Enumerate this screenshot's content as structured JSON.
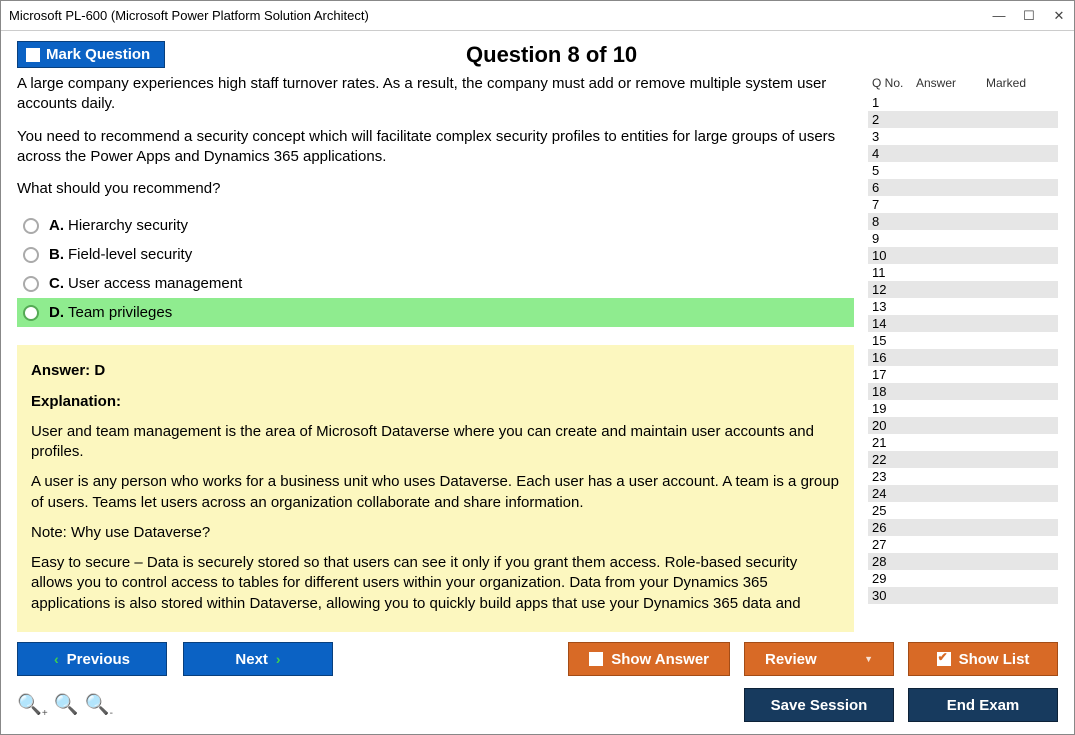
{
  "window": {
    "title": "Microsoft PL-600 (Microsoft Power Platform Solution Architect)"
  },
  "header": {
    "mark_label": "Mark Question",
    "question_title": "Question 8 of 10"
  },
  "question": {
    "para1": "A large company experiences high staff turnover rates. As a result, the company must add or remove multiple system user accounts daily.",
    "para2": "You need to recommend a security concept which will facilitate complex security profiles to entities for large groups of users across the Power Apps and Dynamics 365 applications.",
    "para3": "What should you recommend?"
  },
  "options": {
    "a": {
      "label": "A.",
      "text": "Hierarchy security"
    },
    "b": {
      "label": "B.",
      "text": "Field-level security"
    },
    "c": {
      "label": "C.",
      "text": "User access management"
    },
    "d": {
      "label": "D.",
      "text": "Team privileges"
    }
  },
  "answer": {
    "header": "Answer: D",
    "explanation_label": "Explanation:",
    "p1": "User and team management is the area of Microsoft Dataverse where you can create and maintain user accounts and profiles.",
    "p2": "A user is any person who works for a business unit who uses Dataverse. Each user has a user account. A team is a group of users. Teams let users across an organization collaborate and share information.",
    "p3": "Note: Why use Dataverse?",
    "p4": " Easy to secure – Data is securely stored so that users can see it only if you grant them access. Role-based security allows you to control access to tables for different users within your organization.  Data from your Dynamics 365 applications is also stored within Dataverse, allowing you to quickly build apps that use your Dynamics 365 data and"
  },
  "sidepanel": {
    "h_q": "Q No.",
    "h_a": "Answer",
    "h_m": "Marked",
    "rows": [
      "1",
      "2",
      "3",
      "4",
      "5",
      "6",
      "7",
      "8",
      "9",
      "10",
      "11",
      "12",
      "13",
      "14",
      "15",
      "16",
      "17",
      "18",
      "19",
      "20",
      "21",
      "22",
      "23",
      "24",
      "25",
      "26",
      "27",
      "28",
      "29",
      "30"
    ]
  },
  "footer": {
    "prev": "Previous",
    "next": "Next",
    "show_answer": "Show Answer",
    "review": "Review",
    "show_list": "Show List",
    "save_session": "Save Session",
    "end_exam": "End Exam"
  }
}
